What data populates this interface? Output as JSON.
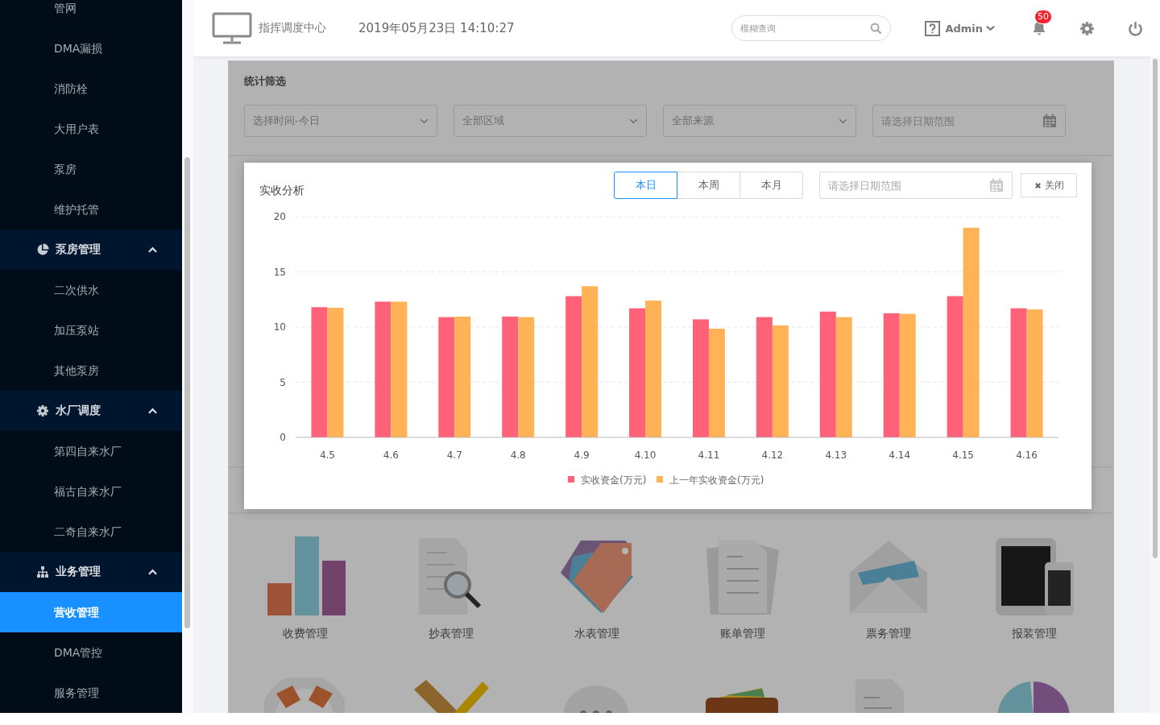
{
  "sidebar": {
    "items": [
      {
        "kind": "item",
        "label": "管网",
        "selected": false
      },
      {
        "kind": "item",
        "label": "DMA漏损",
        "selected": false
      },
      {
        "kind": "item",
        "label": "消防栓",
        "selected": false
      },
      {
        "kind": "item",
        "label": "大用户表",
        "selected": false
      },
      {
        "kind": "item",
        "label": "泵房",
        "selected": false
      },
      {
        "kind": "item",
        "label": "维护托管",
        "selected": false
      },
      {
        "kind": "group",
        "label": "泵房管理",
        "expanded": true,
        "children": [
          {
            "kind": "item",
            "label": "二次供水",
            "selected": false
          },
          {
            "kind": "item",
            "label": "加压泵站",
            "selected": false
          },
          {
            "kind": "item",
            "label": "其他泵房",
            "selected": false
          }
        ]
      },
      {
        "kind": "group",
        "label": "水厂调度",
        "expanded": true,
        "children": [
          {
            "kind": "item",
            "label": "第四自来水厂",
            "selected": false
          },
          {
            "kind": "item",
            "label": "福古自来水厂",
            "selected": false
          },
          {
            "kind": "item",
            "label": "二奇自来水厂",
            "selected": false
          }
        ]
      },
      {
        "kind": "group",
        "label": "业务管理",
        "expanded": true,
        "children": [
          {
            "kind": "item",
            "label": "营收管理",
            "selected": true
          },
          {
            "kind": "item",
            "label": "DMA管控",
            "selected": false
          },
          {
            "kind": "item",
            "label": "服务管理",
            "selected": false
          }
        ]
      }
    ]
  },
  "header": {
    "title": "指挥调度中心",
    "datetime": "2019年05月23日 14:10:27",
    "search": {
      "placeholder": "模糊查询"
    },
    "user": "Admin",
    "notifications": "50"
  },
  "filters": {
    "title": "统计筛选",
    "selects": [
      "选择时间-今日",
      "全部区域",
      "全部来源"
    ],
    "date": {
      "placeholder": "请选择日期范围"
    }
  },
  "apps": [
    {
      "label": "收费管理"
    },
    {
      "label": "抄表管理"
    },
    {
      "label": "水表管理"
    },
    {
      "label": "账单管理"
    },
    {
      "label": "票务管理"
    },
    {
      "label": "报装管理"
    }
  ],
  "dialog": {
    "title": "实收分析",
    "tabs": [
      {
        "label": "本日",
        "selected": true
      },
      {
        "label": "本周",
        "selected": false
      },
      {
        "label": "本月",
        "selected": false
      }
    ],
    "date": {
      "placeholder": "请选择日期范围"
    },
    "close": "关闭",
    "chart_data": {
      "type": "bar",
      "categories": [
        "4.5",
        "4.6",
        "4.7",
        "4.8",
        "4.9",
        "4.10",
        "4.11",
        "4.12",
        "4.13",
        "4.14",
        "4.15",
        "4.16"
      ],
      "series": [
        {
          "name": "实收资金(万元)",
          "color": "#ff6178",
          "values": [
            11.8,
            12.3,
            10.9,
            10.95,
            12.8,
            11.7,
            10.7,
            10.9,
            11.4,
            11.25,
            12.8,
            11.7
          ]
        },
        {
          "name": "上一年实收资金(万元)",
          "color": "#ffb356",
          "values": [
            11.75,
            12.3,
            10.95,
            10.9,
            13.7,
            12.4,
            9.85,
            10.15,
            10.9,
            11.2,
            19.0,
            11.6
          ]
        }
      ],
      "ylim": [
        0,
        20
      ],
      "yticks": [
        0,
        5,
        10,
        15,
        20
      ],
      "grid": true,
      "legend": true
    }
  }
}
